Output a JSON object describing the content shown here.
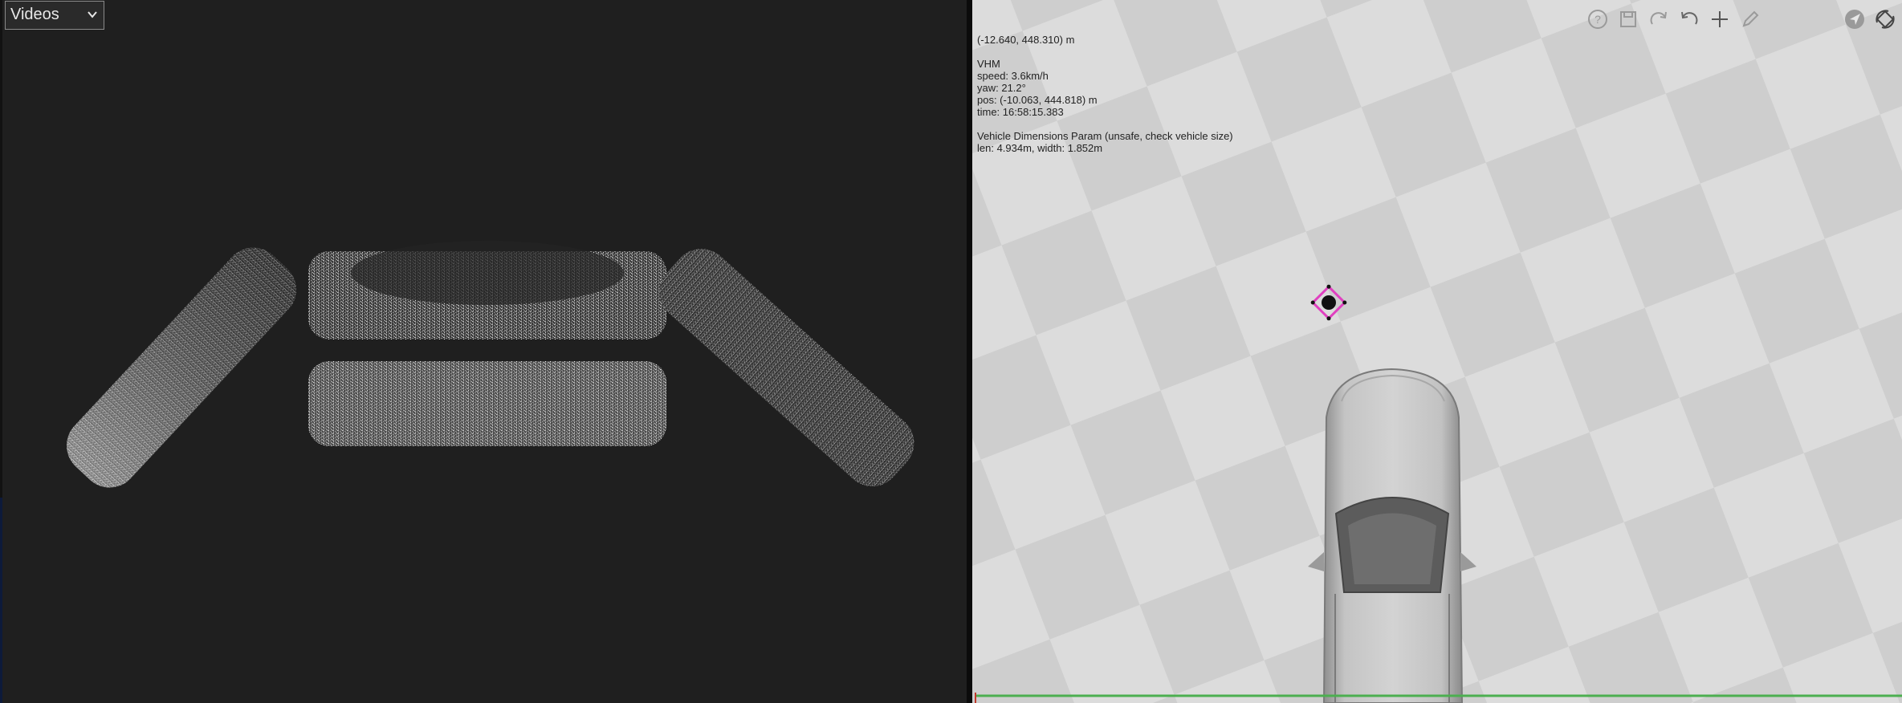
{
  "videos_select": {
    "value": "Videos"
  },
  "map_info": {
    "cursor": "(-12.640, 448.310) m",
    "vehicle_label": "VHM",
    "speed": "speed: 3.6km/h",
    "yaw": "yaw: 21.2°",
    "pos": "pos: (-10.063, 444.818) m",
    "time": "time: 16:58:15.383",
    "dimensions_title": "Vehicle Dimensions Param (unsafe, check vehicle size)",
    "dimensions": "len: 4.934m, width: 1.852m"
  },
  "toolbar": {
    "icons": [
      "help-icon",
      "save-icon",
      "redo-icon",
      "undo-icon",
      "add-icon",
      "pencil-icon",
      "navigate-icon",
      "rotate-view-icon"
    ]
  },
  "colors": {
    "left_bg": "#1f1f1f",
    "map_light": "#dcdcdc",
    "map_dark": "#cfcfcf",
    "marker": "#e040c0",
    "baseline": "#4caf50"
  }
}
